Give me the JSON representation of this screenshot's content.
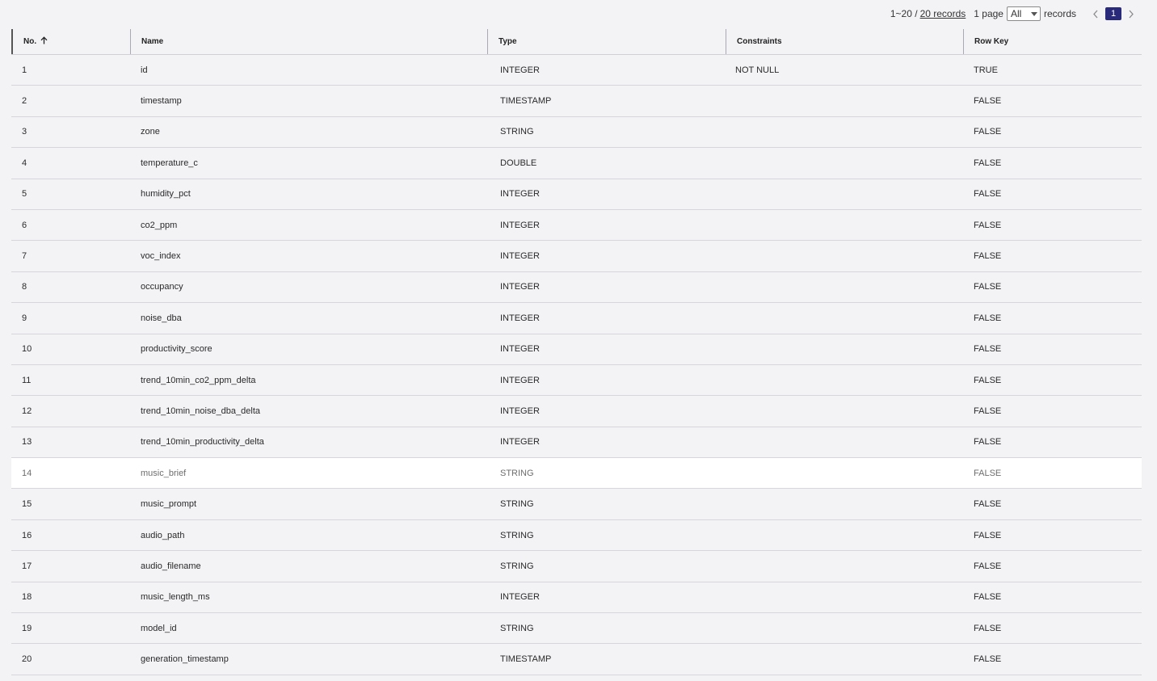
{
  "pager": {
    "range_text": "1~20 /",
    "total_link": "20 records",
    "pages_text": "1 page",
    "page_size_selected": "All",
    "records_label": "records",
    "current_page": "1",
    "prev_icon": "chevron-left-icon",
    "next_icon": "chevron-right-icon"
  },
  "table": {
    "columns": [
      {
        "label": "No.",
        "sort": "ascending",
        "sort_icon": "arrow-up-icon"
      },
      {
        "label": "Name"
      },
      {
        "label": "Type"
      },
      {
        "label": "Constraints"
      },
      {
        "label": "Row Key"
      }
    ],
    "rows": [
      {
        "no": "1",
        "name": "id",
        "type": "INTEGER",
        "constraints": "NOT NULL",
        "row_key": "TRUE"
      },
      {
        "no": "2",
        "name": "timestamp",
        "type": "TIMESTAMP",
        "constraints": "",
        "row_key": "FALSE"
      },
      {
        "no": "3",
        "name": "zone",
        "type": "STRING",
        "constraints": "",
        "row_key": "FALSE"
      },
      {
        "no": "4",
        "name": "temperature_c",
        "type": "DOUBLE",
        "constraints": "",
        "row_key": "FALSE"
      },
      {
        "no": "5",
        "name": "humidity_pct",
        "type": "INTEGER",
        "constraints": "",
        "row_key": "FALSE"
      },
      {
        "no": "6",
        "name": "co2_ppm",
        "type": "INTEGER",
        "constraints": "",
        "row_key": "FALSE"
      },
      {
        "no": "7",
        "name": "voc_index",
        "type": "INTEGER",
        "constraints": "",
        "row_key": "FALSE"
      },
      {
        "no": "8",
        "name": "occupancy",
        "type": "INTEGER",
        "constraints": "",
        "row_key": "FALSE"
      },
      {
        "no": "9",
        "name": "noise_dba",
        "type": "INTEGER",
        "constraints": "",
        "row_key": "FALSE"
      },
      {
        "no": "10",
        "name": "productivity_score",
        "type": "INTEGER",
        "constraints": "",
        "row_key": "FALSE"
      },
      {
        "no": "11",
        "name": "trend_10min_co2_ppm_delta",
        "type": "INTEGER",
        "constraints": "",
        "row_key": "FALSE"
      },
      {
        "no": "12",
        "name": "trend_10min_noise_dba_delta",
        "type": "INTEGER",
        "constraints": "",
        "row_key": "FALSE"
      },
      {
        "no": "13",
        "name": "trend_10min_productivity_delta",
        "type": "INTEGER",
        "constraints": "",
        "row_key": "FALSE"
      },
      {
        "no": "14",
        "name": "music_brief",
        "type": "STRING",
        "constraints": "",
        "row_key": "FALSE",
        "highlighted": true
      },
      {
        "no": "15",
        "name": "music_prompt",
        "type": "STRING",
        "constraints": "",
        "row_key": "FALSE"
      },
      {
        "no": "16",
        "name": "audio_path",
        "type": "STRING",
        "constraints": "",
        "row_key": "FALSE"
      },
      {
        "no": "17",
        "name": "audio_filename",
        "type": "STRING",
        "constraints": "",
        "row_key": "FALSE"
      },
      {
        "no": "18",
        "name": "music_length_ms",
        "type": "INTEGER",
        "constraints": "",
        "row_key": "FALSE"
      },
      {
        "no": "19",
        "name": "model_id",
        "type": "STRING",
        "constraints": "",
        "row_key": "FALSE"
      },
      {
        "no": "20",
        "name": "generation_timestamp",
        "type": "TIMESTAMP",
        "constraints": "",
        "row_key": "FALSE"
      }
    ]
  },
  "colors": {
    "page_background": "#f3f3f6",
    "highlight_row": "#ffffff",
    "current_page_badge": "#2a2a7a"
  }
}
